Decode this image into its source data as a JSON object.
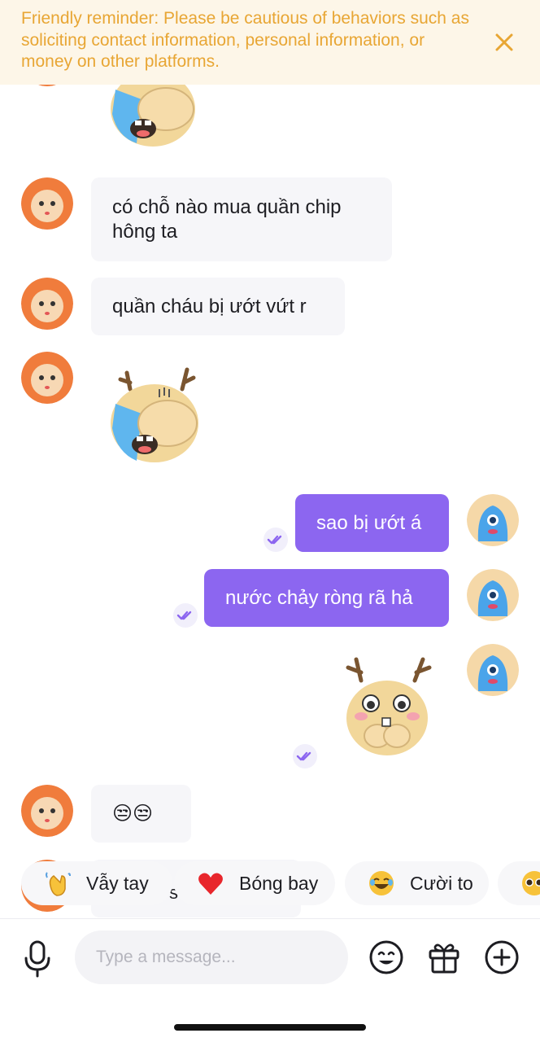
{
  "banner": {
    "text": "Friendly reminder: Please be cautious of behaviors such as soliciting contact information, personal information, or money on other platforms.",
    "close_icon": "close-icon",
    "color": "#e8a634",
    "background": "#fdf6e8"
  },
  "messages": {
    "in_1": "có chỗ nào mua quần chip hông ta",
    "in_2": "quần cháu bị ướt vứt r",
    "out_1": "sao bị ướt á",
    "out_2": "nước chảy ròng rã hả",
    "in_3": "😒😒",
    "in_4_partial": "s"
  },
  "stickers": {
    "crying_deer": "crying-deer-sticker",
    "shy_deer": "shy-deer-sticker"
  },
  "quick_replies": [
    {
      "emoji": "👋",
      "label": "Vẫy tay"
    },
    {
      "emoji": "❤️",
      "label": "Bóng bay"
    },
    {
      "emoji": "😂",
      "label": "Cười to"
    },
    {
      "emoji": "🥺",
      "label": ""
    }
  ],
  "composer": {
    "placeholder": "Type a message...",
    "icons": [
      "microphone-icon",
      "emoji-icon",
      "gift-icon",
      "add-icon"
    ]
  },
  "colors": {
    "outgoing_bubble": "#8c66f0",
    "incoming_bubble": "#f6f6f9",
    "read_receipt": "#8c66f0"
  }
}
